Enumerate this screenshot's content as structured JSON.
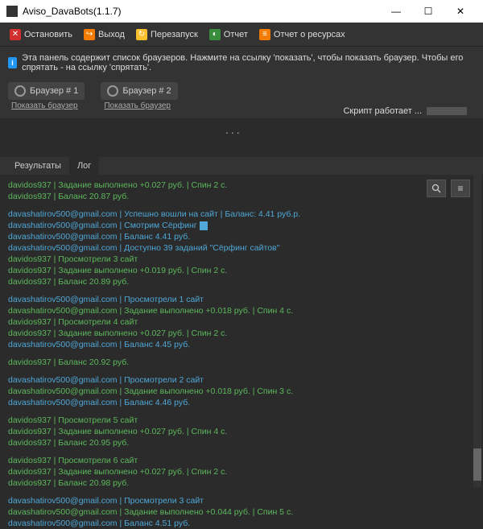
{
  "window": {
    "title": "Aviso_DavaBots(1.1.7)"
  },
  "toolbar": {
    "stop": "Остановить",
    "exit": "Выход",
    "restart": "Перезапуск",
    "report": "Отчет",
    "resources": "Отчет о ресурсах"
  },
  "info": "Эта панель содержит список браузеров. Нажмите на ссылку 'показать', чтобы показать браузер. Чтобы его спрятать - на ссылку 'спрятать'.",
  "browsers": [
    {
      "label": "Браузер # 1",
      "link": "Показать браузер"
    },
    {
      "label": "Браузер # 2",
      "link": "Показать браузер"
    }
  ],
  "status": "Скрипт работает ...",
  "tabs": {
    "results": "Результаты",
    "log": "Лог"
  },
  "log": [
    {
      "c": "g",
      "t": "davidos937 | Задание выполнено +0.027 руб. | Спин 2 с."
    },
    {
      "c": "g",
      "t": "davidos937 | Баланс 20.87 руб."
    },
    {
      "c": "sep"
    },
    {
      "c": "b",
      "t": "davashatirov500@gmail.com | Успешно вошли на сайт | Баланс: 4.41 руб.р."
    },
    {
      "c": "b",
      "t": "davashatirov500@gmail.com | Смотрим Сёрфинг ",
      "cursor": true
    },
    {
      "c": "b",
      "t": "davashatirov500@gmail.com | Баланс 4.41 руб."
    },
    {
      "c": "b",
      "t": "davashatirov500@gmail.com | Доступно 39 заданий \"Сёрфинг сайтов\""
    },
    {
      "c": "g",
      "t": "davidos937 | Просмотрели 3 сайт"
    },
    {
      "c": "g",
      "t": "davidos937 | Задание выполнено +0.019 руб. | Спин 2 с."
    },
    {
      "c": "g",
      "t": "davidos937 | Баланс 20.89 руб."
    },
    {
      "c": "sep"
    },
    {
      "c": "b",
      "t": "davashatirov500@gmail.com | Просмотрели 1 сайт"
    },
    {
      "c": "g",
      "t": "davashatirov500@gmail.com | Задание выполнено +0.018 руб. | Спин 4 с."
    },
    {
      "c": "g",
      "t": "davidos937 | Просмотрели 4 сайт"
    },
    {
      "c": "g",
      "t": "davidos937 | Задание выполнено +0.027 руб. | Спин 2 с."
    },
    {
      "c": "b",
      "t": "davashatirov500@gmail.com | Баланс 4.45 руб."
    },
    {
      "c": "sep"
    },
    {
      "c": "g",
      "t": "davidos937 | Баланс 20.92 руб."
    },
    {
      "c": "sep"
    },
    {
      "c": "b",
      "t": "davashatirov500@gmail.com | Просмотрели 2 сайт"
    },
    {
      "c": "g",
      "t": "davashatirov500@gmail.com | Задание выполнено +0.018 руб. | Спин 3 с."
    },
    {
      "c": "b",
      "t": "davashatirov500@gmail.com | Баланс 4.46 руб."
    },
    {
      "c": "sep"
    },
    {
      "c": "g",
      "t": "davidos937 | Просмотрели 5 сайт"
    },
    {
      "c": "g",
      "t": "davidos937 | Задание выполнено +0.027 руб. | Спин 4 с."
    },
    {
      "c": "g",
      "t": "davidos937 | Баланс 20.95 руб."
    },
    {
      "c": "sep"
    },
    {
      "c": "g",
      "t": "davidos937 | Просмотрели 6 сайт"
    },
    {
      "c": "g",
      "t": "davidos937 | Задание выполнено +0.027 руб. | Спин 2 с."
    },
    {
      "c": "g",
      "t": "davidos937 | Баланс 20.98 руб."
    },
    {
      "c": "sep"
    },
    {
      "c": "b",
      "t": "davashatirov500@gmail.com | Просмотрели 3 сайт"
    },
    {
      "c": "g",
      "t": "davashatirov500@gmail.com | Задание выполнено +0.044 руб. | Спин 5 с."
    },
    {
      "c": "b",
      "t": "davashatirov500@gmail.com | Баланс 4.51 руб."
    }
  ]
}
